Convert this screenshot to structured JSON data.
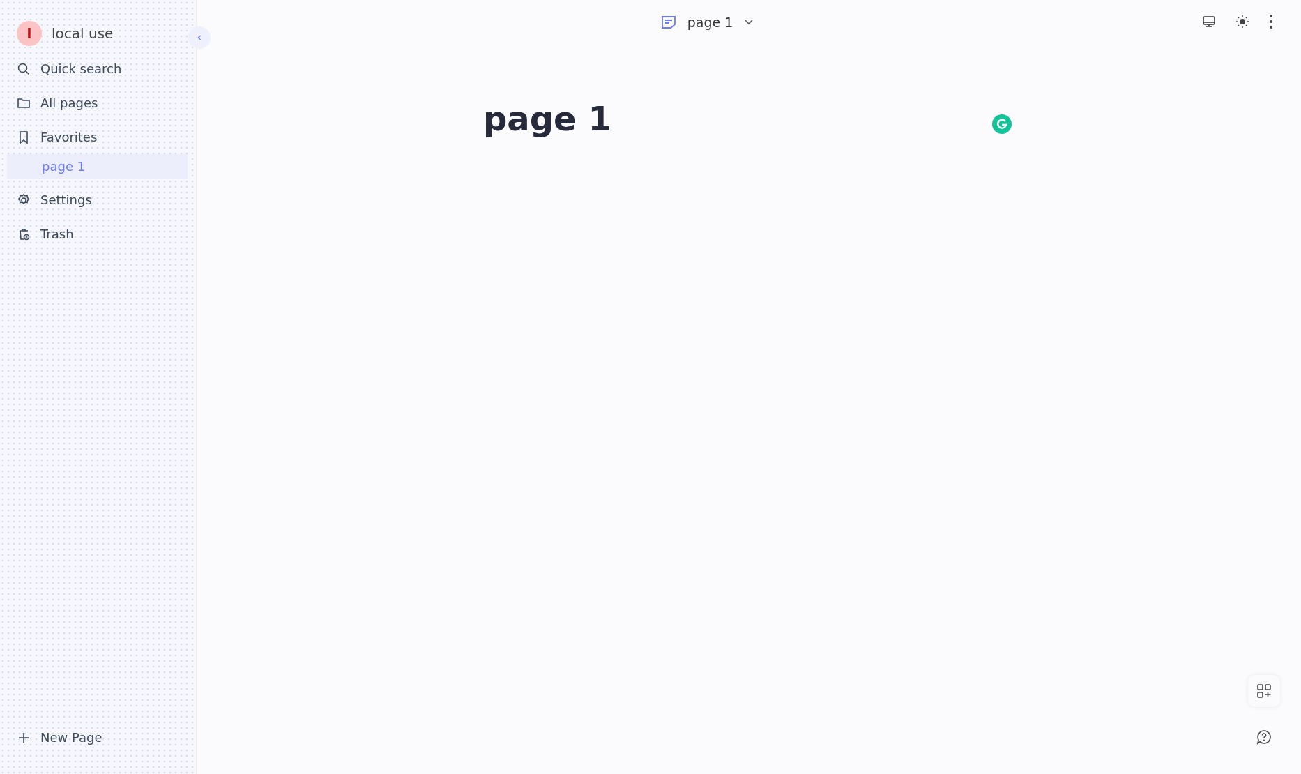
{
  "workspace": {
    "avatar": "l",
    "name": "local use"
  },
  "sidebar": {
    "items": [
      {
        "kind": "search",
        "label": "Quick search"
      },
      {
        "kind": "folder",
        "label": "All pages"
      },
      {
        "kind": "bookmark",
        "label": "Favorites",
        "children": [
          {
            "label": "page 1",
            "selected": true
          }
        ]
      },
      {
        "kind": "settings",
        "label": "Settings"
      },
      {
        "kind": "trash",
        "label": "Trash"
      }
    ],
    "new_page": "New Page"
  },
  "header": {
    "title": "page 1"
  },
  "page": {
    "title": "page 1"
  }
}
